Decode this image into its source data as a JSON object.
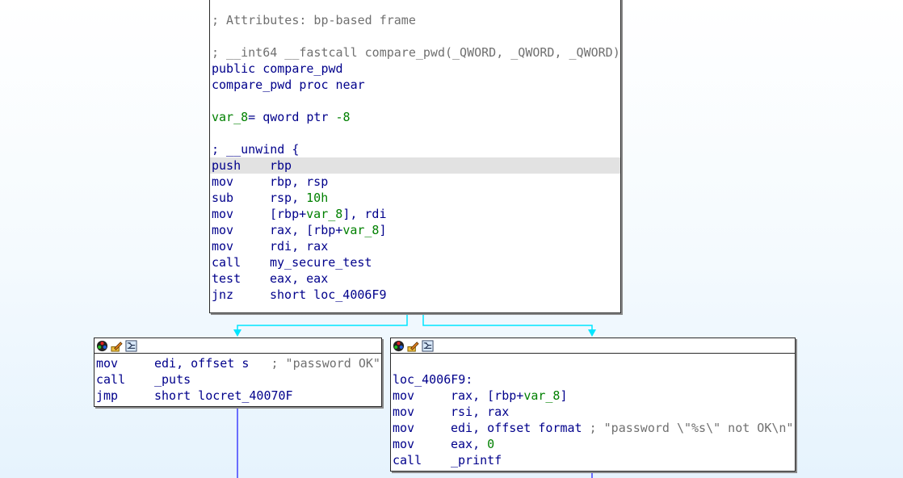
{
  "main_block": {
    "lines": [
      {
        "type": "blank"
      },
      {
        "type": "comment",
        "text": "; Attributes: bp-based frame"
      },
      {
        "type": "blank"
      },
      {
        "type": "comment",
        "text": "; __int64 __fastcall compare_pwd(_QWORD, _QWORD, _QWORD)"
      },
      {
        "type": "code",
        "text": "public compare_pwd"
      },
      {
        "type": "code",
        "text": "compare_pwd proc near"
      },
      {
        "type": "blank"
      },
      {
        "type": "var",
        "name": "var_8",
        "rest": "= qword ptr ",
        "value": "-8"
      },
      {
        "type": "blank"
      },
      {
        "type": "code",
        "text": "; __unwind {"
      }
    ],
    "instructions": [
      {
        "mn": "push",
        "ops": [
          {
            "t": "op",
            "v": "rbp"
          }
        ],
        "highlight": true
      },
      {
        "mn": "mov",
        "ops": [
          {
            "t": "op",
            "v": "rbp, rsp"
          }
        ]
      },
      {
        "mn": "sub",
        "ops": [
          {
            "t": "op",
            "v": "rsp, "
          },
          {
            "t": "num",
            "v": "10h"
          }
        ]
      },
      {
        "mn": "mov",
        "ops": [
          {
            "t": "op",
            "v": "[rbp+"
          },
          {
            "t": "var",
            "v": "var_8"
          },
          {
            "t": "op",
            "v": "], rdi"
          }
        ]
      },
      {
        "mn": "mov",
        "ops": [
          {
            "t": "op",
            "v": "rax, [rbp+"
          },
          {
            "t": "var",
            "v": "var_8"
          },
          {
            "t": "op",
            "v": "]"
          }
        ]
      },
      {
        "mn": "mov",
        "ops": [
          {
            "t": "op",
            "v": "rdi, rax"
          }
        ]
      },
      {
        "mn": "call",
        "ops": [
          {
            "t": "op",
            "v": "my_secure_test"
          }
        ]
      },
      {
        "mn": "test",
        "ops": [
          {
            "t": "op",
            "v": "eax, eax"
          }
        ]
      },
      {
        "mn": "jnz",
        "ops": [
          {
            "t": "op",
            "v": "short loc_4006F9"
          }
        ]
      }
    ]
  },
  "left_block": {
    "instructions": [
      {
        "mn": "mov",
        "ops": [
          {
            "t": "op",
            "v": "edi, offset s   "
          },
          {
            "t": "cmt",
            "v": "; \"password OK\""
          }
        ]
      },
      {
        "mn": "call",
        "ops": [
          {
            "t": "op",
            "v": "_puts"
          }
        ]
      },
      {
        "mn": "jmp",
        "ops": [
          {
            "t": "op",
            "v": "short locret_40070F"
          }
        ]
      }
    ]
  },
  "right_block": {
    "label": "loc_4006F9:",
    "instructions": [
      {
        "mn": "mov",
        "ops": [
          {
            "t": "op",
            "v": "rax, [rbp+"
          },
          {
            "t": "var",
            "v": "var_8"
          },
          {
            "t": "op",
            "v": "]"
          }
        ]
      },
      {
        "mn": "mov",
        "ops": [
          {
            "t": "op",
            "v": "rsi, rax"
          }
        ]
      },
      {
        "mn": "mov",
        "ops": [
          {
            "t": "op",
            "v": "edi, offset format "
          },
          {
            "t": "cmt",
            "v": "; \"password \\\"%s\\\" not OK\\n\""
          }
        ]
      },
      {
        "mn": "mov",
        "ops": [
          {
            "t": "op",
            "v": "eax, "
          },
          {
            "t": "num",
            "v": "0"
          }
        ]
      },
      {
        "mn": "call",
        "ops": [
          {
            "t": "op",
            "v": "_printf"
          }
        ]
      }
    ]
  },
  "header_icons": [
    "palette-icon",
    "edit-icon",
    "graph-view-icon"
  ],
  "colors": {
    "keyword": "#00008b",
    "comment": "#707070",
    "number": "#008000",
    "true_edge": "#00e5ff",
    "false_edge": "#4040ff",
    "highlight": "#e2e2e2"
  }
}
